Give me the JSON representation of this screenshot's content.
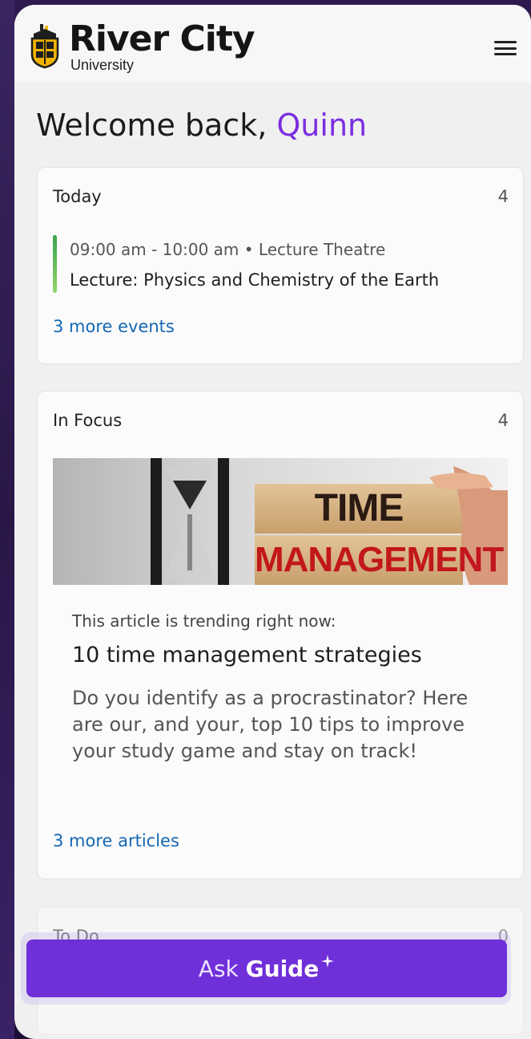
{
  "brand": {
    "name": "River City",
    "subtitle": "University"
  },
  "welcome": {
    "greeting": "Welcome back,",
    "user_name": "Quinn"
  },
  "today": {
    "title": "Today",
    "count": "4",
    "event": {
      "time": "09:00 am  -  10:00 am • Lecture Theatre",
      "name": "Lecture: Physics and Chemistry of the Earth"
    },
    "more_link": "3 more events"
  },
  "in_focus": {
    "title": "In Focus",
    "count": "4",
    "image_words": [
      "TIME",
      "MANAGEMENT"
    ],
    "kicker": "This article is trending right now:",
    "article_title": "10 time management strategies",
    "article_body": "Do you identify as a procrastinator? Here are our, and your, top 10 tips to improve your study game and stay on track!",
    "more_link": "3 more articles"
  },
  "todo": {
    "title": "To Do",
    "count": "0"
  },
  "ask_button": {
    "label_light": "Ask ",
    "label_strong": "Guide"
  },
  "colors": {
    "accent": "#6f2fd9",
    "name_highlight": "#7a2ee0",
    "link": "#1467b3",
    "event_bar": "#4cb35a"
  },
  "icons": [
    "university-crest-icon",
    "hamburger-menu-icon",
    "sparkle-icon"
  ]
}
